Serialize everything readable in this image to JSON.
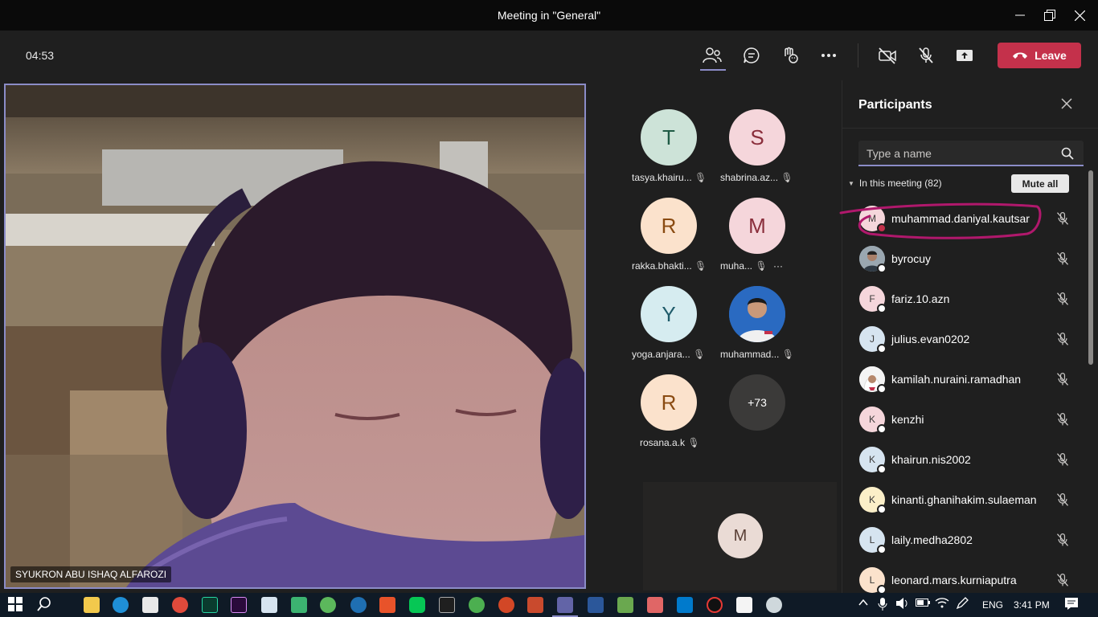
{
  "window": {
    "title": "Meeting in \"General\""
  },
  "toolbar": {
    "timer": "04:53",
    "leave_label": "Leave"
  },
  "main_video": {
    "name": "SYUKRON ABU ISHAQ ALFAROZI"
  },
  "tiles": [
    {
      "initial": "T",
      "name": "tasya.khairu...",
      "bg": "#cde3d8",
      "fg": "#1f5b45"
    },
    {
      "initial": "S",
      "name": "shabrina.az...",
      "bg": "#f5d6db",
      "fg": "#8a2e3b"
    },
    {
      "initial": "R",
      "name": "rakka.bhakti...",
      "bg": "#fbe2cc",
      "fg": "#8a4b12"
    },
    {
      "initial": "M",
      "name": "muha...",
      "bg": "#f5d6db",
      "fg": "#8a2e3b"
    },
    {
      "initial": "Y",
      "name": "yoga.anjara...",
      "bg": "#d6ecf0",
      "fg": "#1f5b6a"
    },
    {
      "initial": "",
      "name": "muhammad...",
      "bg": "#1f5fb2",
      "fg": "#fff"
    },
    {
      "initial": "R",
      "name": "rosana.a.k",
      "bg": "#fbe2cc",
      "fg": "#8a4b12"
    },
    {
      "initial": "+73",
      "name": "",
      "bg": "#3b3a39",
      "fg": "#fff"
    }
  ],
  "bottom_tile": {
    "initial": "M"
  },
  "panel": {
    "title": "Participants",
    "search_placeholder": "Type a name",
    "in_meeting_label": "In this meeting (82)",
    "mute_all_label": "Mute all",
    "participants": [
      {
        "initial": "M",
        "name": "muhammad.daniyal.kautsar",
        "bg": "#f5d6db",
        "status": "#c4314b"
      },
      {
        "initial": "",
        "name": "byrocuy",
        "bg": "#8c9aa6",
        "status": "#ffffff"
      },
      {
        "initial": "F",
        "name": "fariz.10.azn",
        "bg": "#f5d6db",
        "status": "#ffffff"
      },
      {
        "initial": "J",
        "name": "julius.evan0202",
        "bg": "#d6e4f0",
        "status": "#ffffff"
      },
      {
        "initial": "",
        "name": "kamilah.nuraini.ramadhan",
        "bg": "#f0f0f0",
        "status": "#ffffff"
      },
      {
        "initial": "K",
        "name": "kenzhi",
        "bg": "#f5d6db",
        "status": "#ffffff"
      },
      {
        "initial": "K",
        "name": "khairun.nis2002",
        "bg": "#d6e4f0",
        "status": "#ffffff"
      },
      {
        "initial": "K",
        "name": "kinanti.ghanihakim.sulaeman",
        "bg": "#fbefc8",
        "status": "#ffffff"
      },
      {
        "initial": "L",
        "name": "laily.medha2802",
        "bg": "#d6e4f0",
        "status": "#ffffff"
      },
      {
        "initial": "L",
        "name": "leonard.mars.kurniaputra",
        "bg": "#fbe2cc",
        "status": "#ffffff"
      }
    ]
  },
  "taskbar": {
    "lang": "ENG",
    "time": "3:41 PM"
  },
  "colors": {
    "accent": "#8b8cc7",
    "leave": "#c4314b",
    "annotation": "#b0186c"
  }
}
